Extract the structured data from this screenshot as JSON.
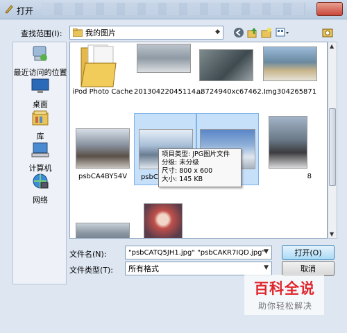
{
  "window": {
    "title": "打开"
  },
  "toolbar": {
    "look_in_label": "查找范围(I):",
    "look_in_value": "我的图片",
    "icons": [
      "back-icon",
      "up-folder-icon",
      "new-folder-icon",
      "view-menu-icon",
      "desktop-shortcut-icon"
    ]
  },
  "places": [
    {
      "label": "最近访问的位置",
      "icon": "recent-icon"
    },
    {
      "label": "桌面",
      "icon": "desktop-icon"
    },
    {
      "label": "库",
      "icon": "library-icon"
    },
    {
      "label": "计算机",
      "icon": "computer-icon"
    },
    {
      "label": "网络",
      "icon": "network-icon"
    }
  ],
  "files": [
    {
      "name": "iPod Photo Cache",
      "kind": "folder"
    },
    {
      "name": "20130422045114...",
      "kind": "image"
    },
    {
      "name": "a8724940xc67462...",
      "kind": "image"
    },
    {
      "name": "Img304265871",
      "kind": "image"
    },
    {
      "name": "psbCA4BY54V",
      "kind": "image"
    },
    {
      "name": "psbCAKR7IQD",
      "kind": "image",
      "selected": true
    },
    {
      "name": "psbCAT",
      "kind": "image",
      "selected": true
    },
    {
      "name": "8",
      "kind": "image"
    },
    {
      "name": "",
      "kind": "image"
    },
    {
      "name": "",
      "kind": "image"
    }
  ],
  "tooltip": {
    "lines": [
      "项目类型: JPG图片文件",
      "分级: 未分级",
      "尺寸: 800 x 600",
      "大小: 145 KB"
    ]
  },
  "footer": {
    "filename_label": "文件名(N):",
    "filename_value": "\"psbCATQ5JH1.jpg\" \"psbCAKR7IQD.jpg\"",
    "filetype_label": "文件类型(T):",
    "filetype_value": "所有格式",
    "open_label": "打开(O)",
    "cancel_label": "取消"
  },
  "watermark": {
    "title": "百科全说",
    "subtitle": "助你轻松解决"
  }
}
